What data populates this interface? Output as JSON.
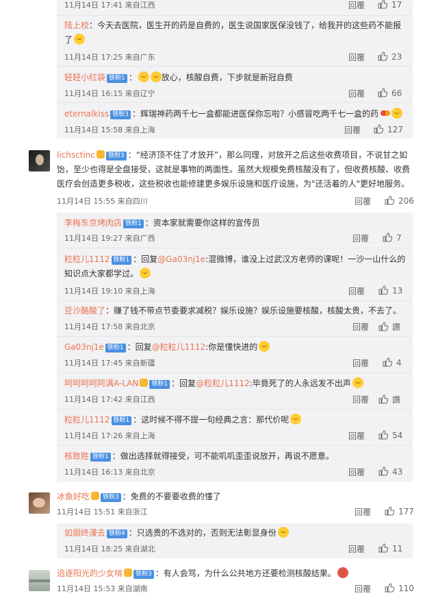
{
  "common": {
    "reply_label": "回覆"
  },
  "top_partial": {
    "meta": "11月14日 17:41 来自江西",
    "likes": "17"
  },
  "replies_group1": [
    {
      "user": "陆上校",
      "text": "：今天去医院，医生开的药是自费的，医生说国家医保没钱了，给我开的这些药不能报了",
      "meta": "11月14日 17:25 来自广东",
      "likes": "23"
    },
    {
      "user": "轻轻小红袋",
      "badge": "铁粉1",
      "text": "放心，核酸自费，下步就是新冠自费",
      "meta": "11月14日 16:15 来自辽宁",
      "likes": "66"
    },
    {
      "user": "eternalkiss",
      "badge": "铁粉3",
      "text": "：辉瑞神药两千七一盒都能进医保你忘啦？小感冒吃两千七一盒的药",
      "meta": "11月14日 15:58 来自上海",
      "likes": "127"
    }
  ],
  "comment1": {
    "user": "lichsctinc",
    "badge": "铁粉3",
    "line1": "：“经济顶不住了才放开”，那么同理，对放开之后这些收费项目，不说甘之如",
    "line2": "饴，至少也得是全盘接受，这就是事物的两面性。虽然大规模免费核酸没有了，但收费核酸、收费",
    "line3": "医疗会创造更多税收，这些税收也能修建更多娱乐设施和医疗设施，为\"还活着的人\"更好地服务。",
    "meta": "11月14日 15:55 来自四川",
    "likes": "206"
  },
  "replies_group2": [
    {
      "user": "李梅东京烤肉店",
      "badge": "铁粉1",
      "text": "：资本家就需要你这样的宣传员",
      "meta": "11月14日 19:27 来自广西",
      "likes": "7"
    },
    {
      "user": "粒粒儿1112",
      "badge": "铁粉1",
      "text": "：回复",
      "mention": "@Ga03nj1e",
      "text2": ":混微博，谁没上过武汉方老师的课呢！一沙一山什么的",
      "line2": "知识点大家都学过。",
      "meta": "11月14日 19:10 来自上海",
      "likes": "13"
    },
    {
      "user": "豆沙酪酸了",
      "text": "：赚了钱不带点节委要求减税？娱乐设施？娱乐设施要核酸，核酸太贵，不去了。",
      "meta": "11月14日 17:58 来自北京",
      "likes": "讚"
    },
    {
      "user": "Ga03nj1e",
      "badge": "铁粉1",
      "text": "：回复",
      "mention": "@粒粒儿1112",
      "text2": ":你是懂快进的",
      "meta": "11月14日 17:45 来自新疆",
      "likes": "4"
    },
    {
      "user": "呵呵呵呵阿满A-LAN",
      "badge": "铁粉1",
      "text": "：回复",
      "mention": "@粒粒儿1112",
      "text2": ":毕竟死了的人永远发不出声",
      "meta": "11月14日 17:42 来自江西",
      "likes": "讚"
    },
    {
      "user": "粒粒儿1112",
      "badge": "铁粉1",
      "text": "：这时候不得不提一句经典之言：那代价呢",
      "meta": "11月14日 17:26 来自上海",
      "likes": "54"
    },
    {
      "user": "核致胜",
      "badge": "铁粉1",
      "text": "：做出选择就得接受，可不能叽叽歪歪说放开，再说不愿意。",
      "meta": "11月14日 16:13 来自北京",
      "likes": "43"
    }
  ],
  "comment2": {
    "user": "冰鱼好吃",
    "badge": "铁粉3",
    "text": "：免费的不要要收费的懂了",
    "meta": "11月14日 15:51 来自浙江",
    "likes": "177"
  },
  "replies_group3": [
    {
      "user": "如烟终漫去",
      "badge": "铁粉4",
      "text": "：只选贵的不选对的，否则无法彰显身份",
      "meta": "11月14日 18:25 来自湖北",
      "likes": "11"
    }
  ],
  "comment3": {
    "user": "追逐阳光的少女啃",
    "badge": "铁粉3",
    "text": "：有人会骂，为什么公共地方还要检测核酸结果。",
    "meta": "11月14日 15:53 来自湖南",
    "likes": "110"
  }
}
